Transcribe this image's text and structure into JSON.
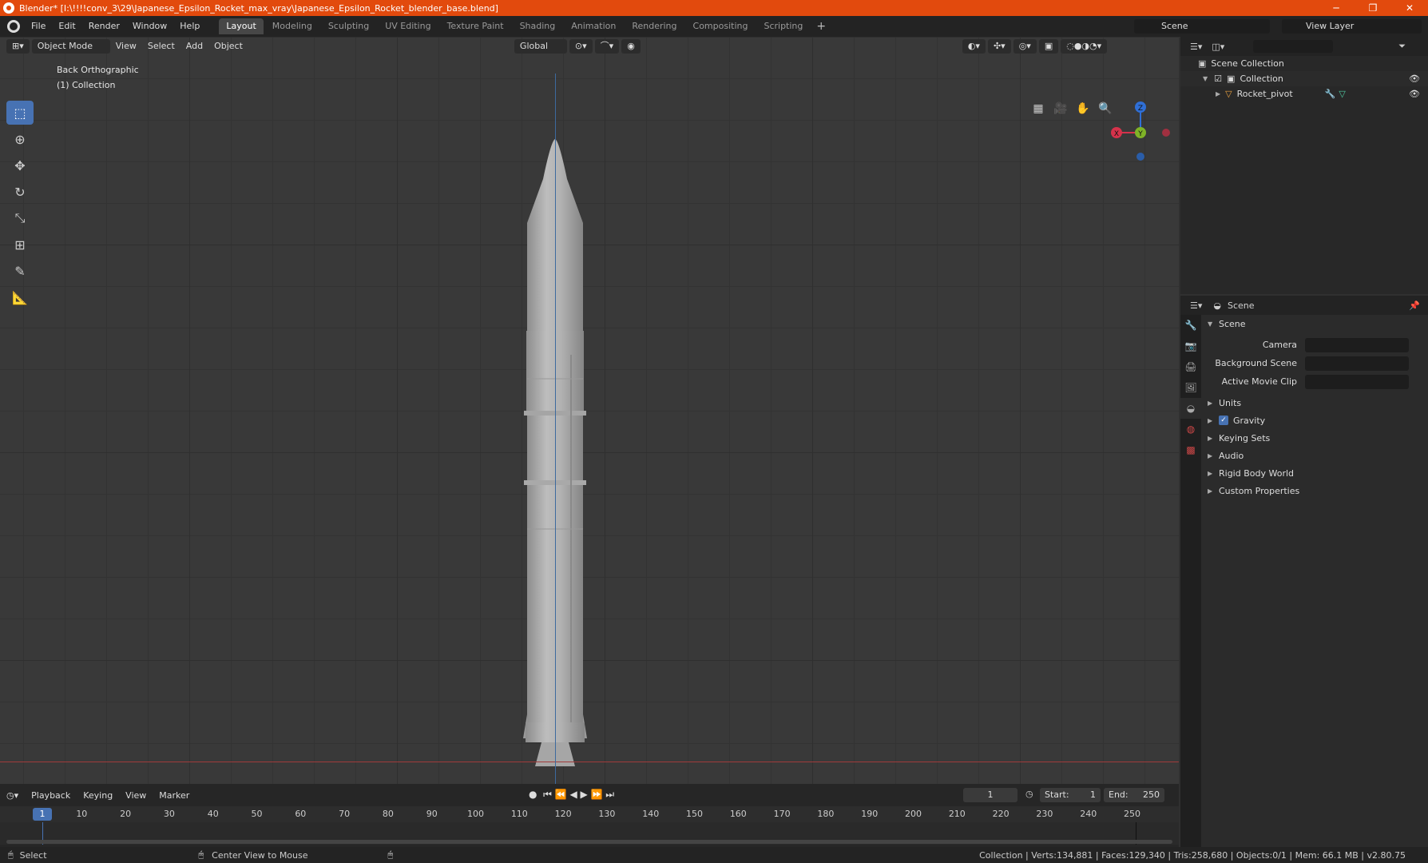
{
  "titlebar": {
    "title": "Blender* [I:\\!!!!conv_3\\29\\Japanese_Epsilon_Rocket_max_vray\\Japanese_Epsilon_Rocket_blender_base.blend]",
    "min": "─",
    "max": "❐",
    "close": "✕"
  },
  "menu": [
    "File",
    "Edit",
    "Render",
    "Window",
    "Help"
  ],
  "workspaces": [
    "Layout",
    "Modeling",
    "Sculpting",
    "UV Editing",
    "Texture Paint",
    "Shading",
    "Animation",
    "Rendering",
    "Compositing",
    "Scripting"
  ],
  "add_ws": "+",
  "scene_name": "Scene",
  "view_layer": "View Layer",
  "viewport": {
    "mode": "Object Mode",
    "menus": [
      "View",
      "Select",
      "Add",
      "Object"
    ],
    "orientation": "Global",
    "view_name": "Back Orthographic",
    "collection_info": "(1) Collection",
    "gizmo": {
      "z": "Z",
      "y": "Y",
      "x": "X"
    }
  },
  "timeline": {
    "menus": [
      "Playback",
      "Keying",
      "View",
      "Marker"
    ],
    "current_frame": "1",
    "start_label": "Start:",
    "start": "1",
    "end_label": "End:",
    "end": "250",
    "ticks": [
      "1",
      "10",
      "20",
      "30",
      "40",
      "50",
      "60",
      "70",
      "80",
      "90",
      "100",
      "110",
      "120",
      "130",
      "140",
      "150",
      "160",
      "170",
      "180",
      "190",
      "200",
      "210",
      "220",
      "230",
      "240",
      "250"
    ]
  },
  "outliner": {
    "scene_collection": "Scene Collection",
    "collection": "Collection",
    "object": "Rocket_pivot"
  },
  "properties": {
    "header": "Scene",
    "panel": "Scene",
    "camera_label": "Camera",
    "bg_scene_label": "Background Scene",
    "movie_clip_label": "Active Movie Clip",
    "subpanels": [
      "Units",
      "Gravity",
      "Keying Sets",
      "Audio",
      "Rigid Body World",
      "Custom Properties"
    ]
  },
  "statusbar": {
    "select": "Select",
    "center": "Center View to Mouse",
    "stats": "Collection | Verts:134,881 | Faces:129,340 | Tris:258,680 | Objects:0/1 | Mem: 66.1 MB | v2.80.75"
  },
  "colors": {
    "accent": "#4772b3",
    "titlebar": "#e24a0d",
    "axis_x": "#a03b3b",
    "axis_y": "#3d6a9e"
  }
}
